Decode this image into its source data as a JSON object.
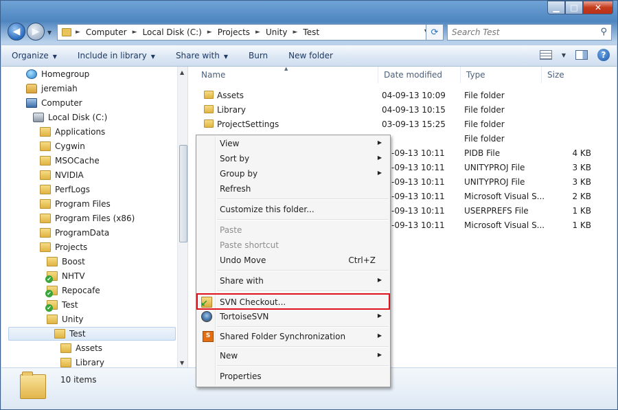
{
  "window": {
    "close_label": "✕",
    "minimize_label": "▁",
    "maximize_label": "□"
  },
  "address": {
    "crumbs": [
      "Computer",
      "Local Disk (C:)",
      "Projects",
      "Unity",
      "Test"
    ],
    "search_placeholder": "Search Test"
  },
  "toolbar": {
    "organize": "Organize",
    "include_in_library": "Include in library",
    "share_with": "Share with",
    "burn": "Burn",
    "new_folder": "New folder",
    "help": "?"
  },
  "nav_tree": [
    {
      "label": "Homegroup",
      "icon": "homegroup-icon"
    },
    {
      "label": "jeremiah",
      "icon": "user-folder-icon"
    },
    {
      "label": "Computer",
      "icon": "computer-icon"
    },
    {
      "label": "Local Disk (C:)",
      "icon": "disk-icon"
    },
    {
      "label": "Applications",
      "icon": "folder-icon"
    },
    {
      "label": "Cygwin",
      "icon": "folder-icon"
    },
    {
      "label": "MSOCache",
      "icon": "folder-icon"
    },
    {
      "label": "NVIDIA",
      "icon": "folder-icon"
    },
    {
      "label": "PerfLogs",
      "icon": "folder-icon"
    },
    {
      "label": "Program Files",
      "icon": "folder-icon"
    },
    {
      "label": "Program Files (x86)",
      "icon": "folder-icon"
    },
    {
      "label": "ProgramData",
      "icon": "folder-icon"
    },
    {
      "label": "Projects",
      "icon": "folder-icon"
    },
    {
      "label": "Boost",
      "icon": "folder-icon"
    },
    {
      "label": "NHTV",
      "icon": "svn-folder-icon"
    },
    {
      "label": "Repocafe",
      "icon": "svn-folder-icon"
    },
    {
      "label": "Test",
      "icon": "svn-folder-icon"
    },
    {
      "label": "Unity",
      "icon": "folder-icon"
    },
    {
      "label": "Test",
      "icon": "folder-icon",
      "selected": true
    },
    {
      "label": "Assets",
      "icon": "folder-icon"
    },
    {
      "label": "Library",
      "icon": "folder-icon"
    }
  ],
  "columns": {
    "name": "Name",
    "date_modified": "Date modified",
    "type": "Type",
    "size": "Size"
  },
  "files": [
    {
      "name": "Assets",
      "date": "04-09-13 10:09",
      "type": "File folder",
      "size": "",
      "folder": true
    },
    {
      "name": "Library",
      "date": "04-09-13 10:15",
      "type": "File folder",
      "size": "",
      "folder": true
    },
    {
      "name": "ProjectSettings",
      "date": "03-09-13 15:25",
      "type": "File folder",
      "size": "",
      "folder": true
    },
    {
      "name": "",
      "date": "",
      "type": "File folder",
      "size": "",
      "folder": true
    },
    {
      "name": "",
      "date": "-09-13 10:11",
      "type": "PIDB File",
      "size": "4 KB"
    },
    {
      "name": "",
      "date": "-09-13 10:11",
      "type": "UNITYPROJ File",
      "size": "3 KB"
    },
    {
      "name": "",
      "date": "-09-13 10:11",
      "type": "UNITYPROJ File",
      "size": "3 KB"
    },
    {
      "name": "",
      "date": "-09-13 10:11",
      "type": "Microsoft Visual S...",
      "size": "2 KB"
    },
    {
      "name": "",
      "date": "-09-13 10:11",
      "type": "USERPREFS File",
      "size": "1 KB"
    },
    {
      "name": "",
      "date": "-09-13 10:11",
      "type": "Microsoft Visual S...",
      "size": "1 KB"
    }
  ],
  "context_menu": {
    "view": "View",
    "sort_by": "Sort by",
    "group_by": "Group by",
    "refresh": "Refresh",
    "customize": "Customize this folder...",
    "paste": "Paste",
    "paste_shortcut": "Paste shortcut",
    "undo_move": "Undo Move",
    "undo_shortcut": "Ctrl+Z",
    "share_with": "Share with",
    "svn_checkout": "SVN Checkout...",
    "tortoisesvn": "TortoiseSVN",
    "shared_folder_sync": "Shared Folder Synchronization",
    "new": "New",
    "properties": "Properties"
  },
  "status": {
    "item_count": "10 items"
  },
  "colors": {
    "highlight_border": "#e0101c",
    "window_frame": "#4f86c0"
  }
}
